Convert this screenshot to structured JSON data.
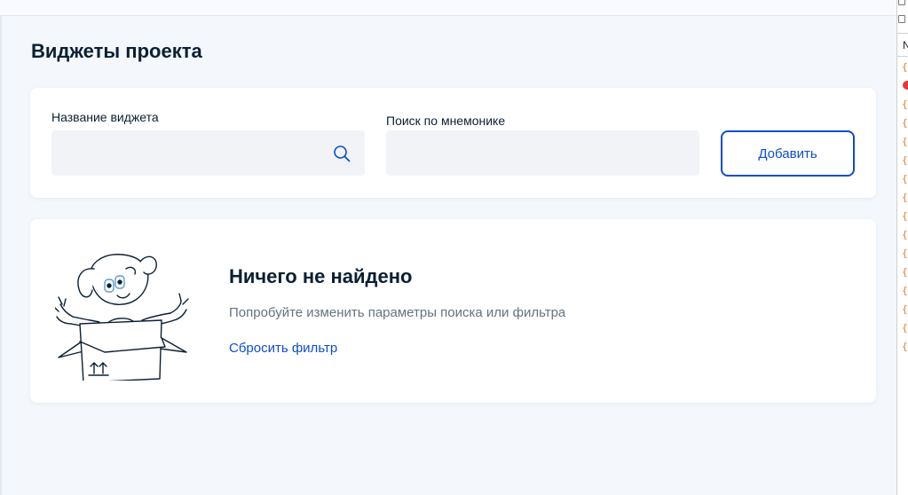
{
  "page": {
    "title": "Виджеты проекта"
  },
  "filters": {
    "name_label": "Название виджета",
    "name_value": "",
    "mnemonic_label": "Поиск по мнемонике",
    "mnemonic_value": "",
    "add_button": "Добавить"
  },
  "empty_state": {
    "title": "Ничего не найдено",
    "message": "Попробуйте изменить параметры поиска или фильтра",
    "reset_link": "Сбросить фильтр",
    "illustration": "dog-in-box-illustration"
  },
  "devtools": {
    "tab_letter": "N",
    "rows": [
      "{",
      "error",
      "{",
      "{",
      "{",
      "{",
      "{",
      "{",
      "{",
      "{",
      "{",
      "{",
      "{",
      "{",
      "{",
      "{"
    ]
  },
  "colors": {
    "accent": "#0d4cd3",
    "title": "#0b1f33",
    "muted": "#66727f",
    "background": "#f4f7fc",
    "input_bg": "#f1f3f6",
    "error": "#e53935",
    "console_icon": "#e8762a"
  }
}
